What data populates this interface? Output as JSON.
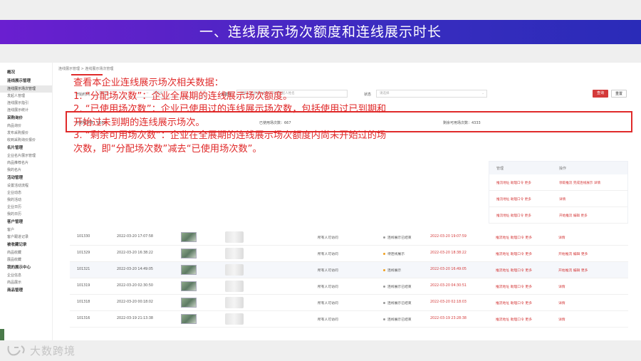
{
  "banner": {
    "title": "一、连线展示场次额度和连线展示时长"
  },
  "sidebar": {
    "groups": [
      {
        "head": "概况",
        "items": []
      },
      {
        "head": "连线展示管理",
        "items": [
          "连线展示场次管理",
          "发起人管理",
          "连线展示指引",
          "连线展示统计"
        ]
      },
      {
        "head": "采购询价",
        "items": [
          "商品询价",
          "发布采购报价",
          "收到采购询价报价"
        ]
      },
      {
        "head": "名片管理",
        "items": [
          "企业名片展示管理",
          "商品推荐名片",
          "我的名片"
        ]
      },
      {
        "head": "活动管理",
        "items": [
          "设置活动流程",
          "企业动态",
          "我的活动",
          "企业日历",
          "我的日历"
        ]
      },
      {
        "head": "客户管理",
        "items": [
          "客户",
          "客户跟进记录"
        ]
      },
      {
        "head": "被收藏记录",
        "items": [
          "商品收藏",
          "展品收藏"
        ]
      },
      {
        "head": "我的展示中心",
        "items": [
          "企业信息",
          "商品展示"
        ]
      },
      {
        "head": "商品管理",
        "items": []
      }
    ],
    "active": "连线展示场次管理"
  },
  "breadcrumb": "连线展示管理 > 连线展示场次管理",
  "filters": {
    "start_label": "开始时间",
    "start_placeholder": "请选择",
    "range_sep": "~",
    "end_placeholder": "请选择",
    "keyword_label": "关键字",
    "keyword_placeholder": "请输入连线展示名称、ID或发起人姓名",
    "status_label": "状态",
    "status_placeholder": "请选择",
    "search_btn": "查询",
    "reset_btn": "重置"
  },
  "stats": {
    "allocated": "分配场次数：5600",
    "used": "已使用场次数：667",
    "remaining": "剩余可用场次数：4333"
  },
  "notes": {
    "l1": "查看本企业连线展示场次相关数据：",
    "l2": "1. “分配场次数”：企业全展期的连线展示场次额度。",
    "l3": "2. “已使用场次数”：企业已使用过的连线展示场次数，包括使用过已到期和",
    "l4": "开始过未到期的连线展示场次。",
    "l5": "3. “剩余可用场次数”：企业在全展期的连线展示场次额度内尚未开始过的场",
    "l6": "次数，即“分配场次数”减去“已使用场次数”。"
  },
  "ops_panel": {
    "head_manage": "管理",
    "head_action": "操作",
    "rows": [
      {
        "manage": "推流地址  助理口令  更多",
        "action": "领取推流  完成连线展示  详情"
      },
      {
        "manage": "推流地址  助理口令  更多",
        "action": "详情"
      },
      {
        "manage": "推流地址  助理口令  更多",
        "action": "开始推流  编辑  更多"
      }
    ]
  },
  "table": {
    "rows": [
      {
        "id": "101330",
        "created": "2022-03-20 17:07:58",
        "visibility": "所有人可访问",
        "status": "连线展示已结束",
        "status_color": "#999999",
        "time": "2022-03-20 19:07:59",
        "manage": "推流地址  助理口令  更多",
        "action": "详情"
      },
      {
        "id": "101329",
        "created": "2022-03-20 16:38:22",
        "visibility": "所有人可访问",
        "status": "待连线展示",
        "status_color": "#f0a020",
        "time": "2022-03-20 18:38:22",
        "manage": "推流地址  助理口令  更多",
        "action": "开始推流  编辑  更多"
      },
      {
        "id": "101321",
        "created": "2022-03-20 14:49:05",
        "visibility": "所有人可访问",
        "status": "连线展示",
        "status_color": "#f0a020",
        "time": "2022-03-20 16:49:05",
        "manage": "推流地址  助理口令  更多",
        "action": "开始推流  编辑  更多"
      },
      {
        "id": "101319",
        "created": "2022-03-20 02:30:50",
        "visibility": "所有人可访问",
        "status": "连线展示已结束",
        "status_color": "#999999",
        "time": "2022-03-20 04:30:51",
        "manage": "推流地址  助理口令  更多",
        "action": "详情"
      },
      {
        "id": "101318",
        "created": "2022-03-20 00:18:02",
        "visibility": "所有人可访问",
        "status": "连线展示已结束",
        "status_color": "#999999",
        "time": "2022-03-20 02:18:03",
        "manage": "推流地址  助理口令  更多",
        "action": "详情"
      },
      {
        "id": "101316",
        "created": "2022-03-19 21:13:38",
        "visibility": "所有人可访问",
        "status": "连线展示已结束",
        "status_color": "#999999",
        "time": "2022-03-19 23:28:38",
        "manage": "推流地址  助理口令  更多",
        "action": "详情"
      }
    ]
  },
  "footer": {
    "brand": "大数跨境",
    "logo_icon": "brand-logo-icon"
  },
  "colors": {
    "banner_start": "#6a1fd0",
    "banner_end": "#2a2bb8",
    "accent_red": "#e02a2a",
    "primary_btn": "#d43a3a"
  }
}
